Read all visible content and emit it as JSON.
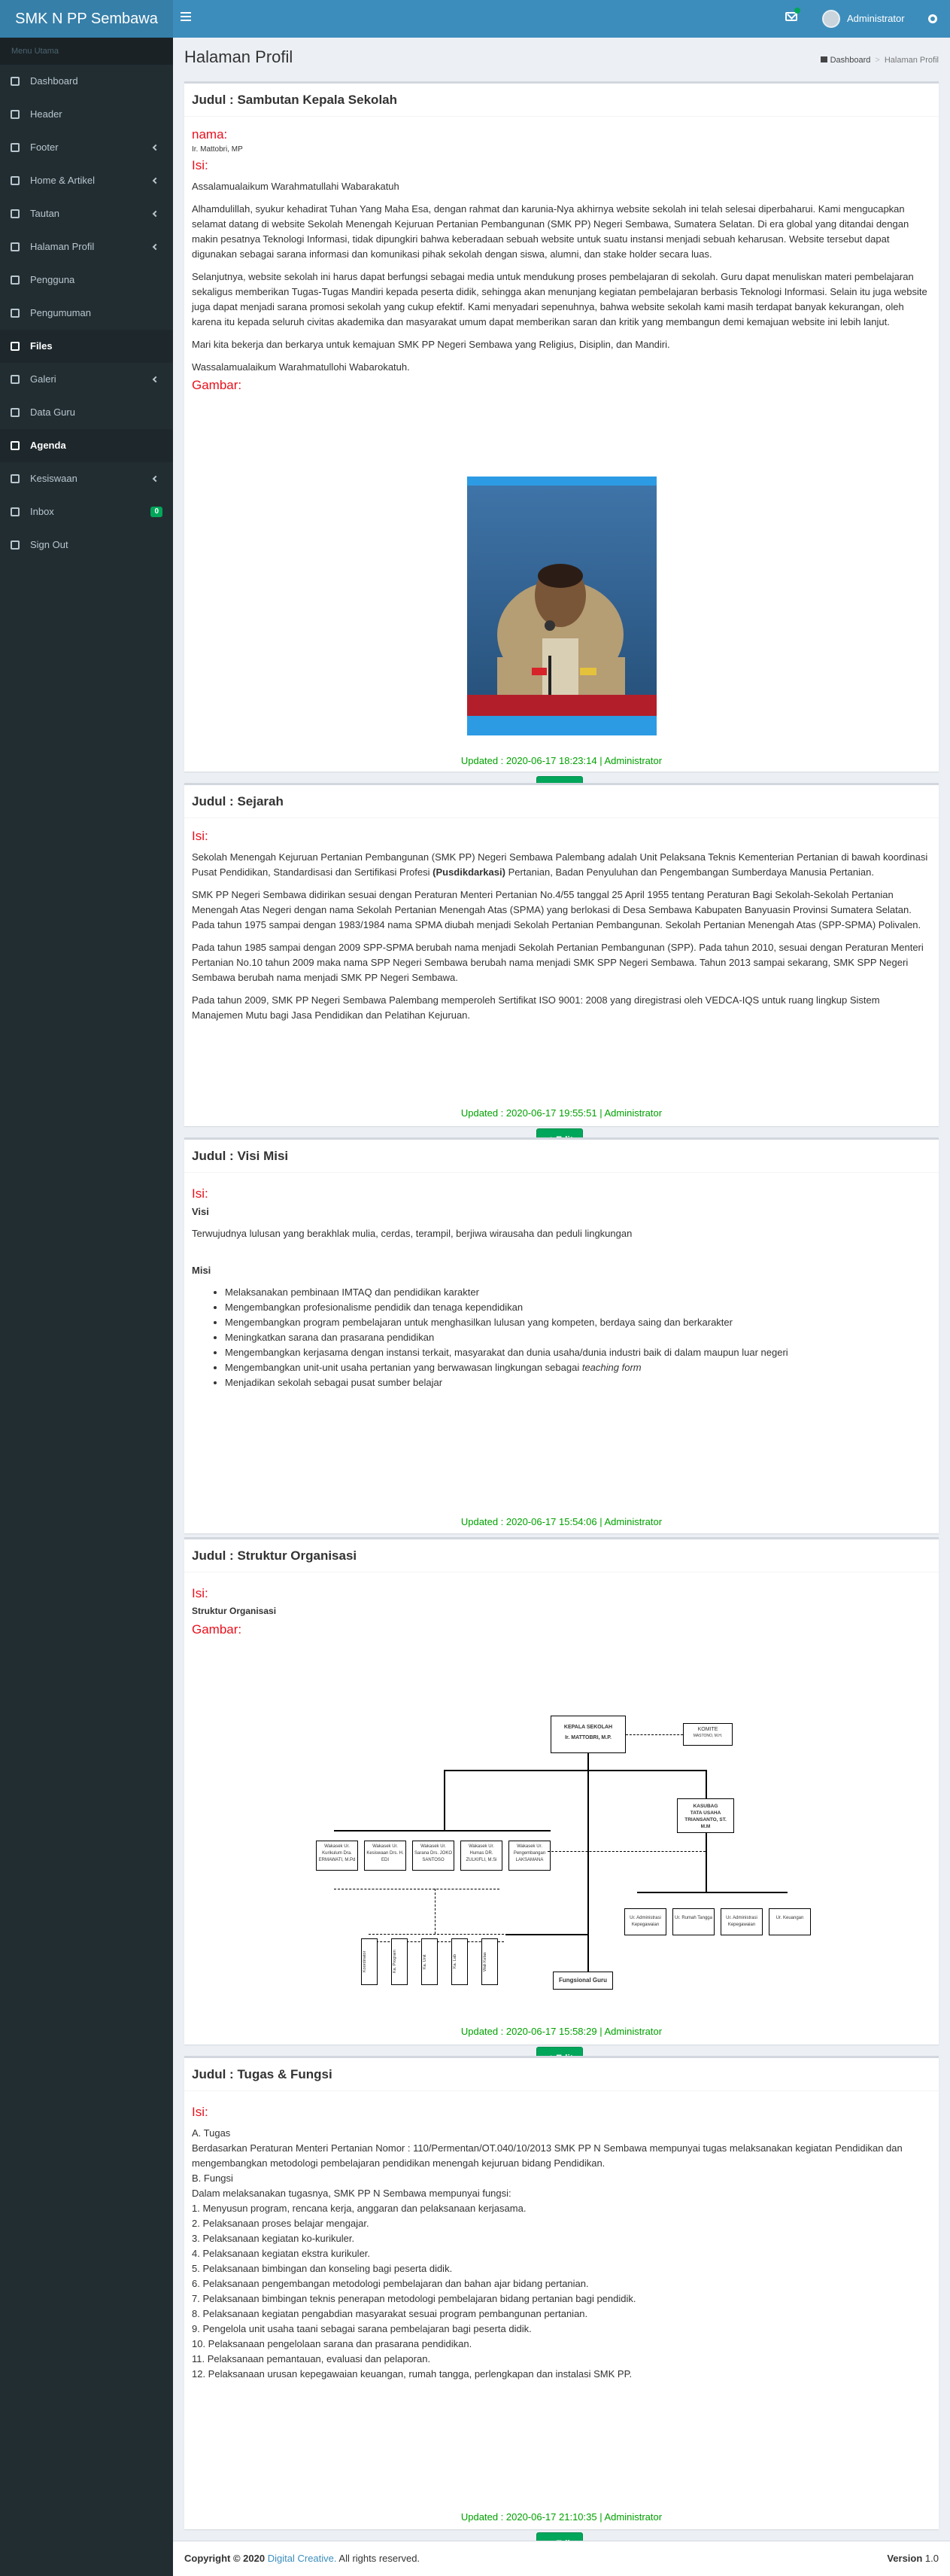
{
  "header": {
    "logo": "SMK N PP Sembawa",
    "user": "Administrator"
  },
  "sidebar": {
    "title": "Menu Utama",
    "items": [
      {
        "label": "Dashboard",
        "icon": "dashboard-icon",
        "caret": false,
        "active": false
      },
      {
        "label": "Header",
        "icon": "list-icon",
        "caret": false,
        "active": false
      },
      {
        "label": "Footer",
        "icon": "list-icon",
        "caret": true,
        "active": false
      },
      {
        "label": "Home & Artikel",
        "icon": "newspaper-icon",
        "caret": true,
        "active": false
      },
      {
        "label": "Tautan",
        "icon": "link-icon",
        "caret": true,
        "active": false
      },
      {
        "label": "Halaman Profil",
        "icon": "home-icon",
        "caret": true,
        "active": false
      },
      {
        "label": "Pengguna",
        "icon": "users-icon",
        "caret": false,
        "active": false
      },
      {
        "label": "Pengumuman",
        "icon": "bullhorn-icon",
        "caret": false,
        "active": false
      },
      {
        "label": "Files",
        "icon": "files-icon",
        "caret": false,
        "active": true
      },
      {
        "label": "Galeri",
        "icon": "image-icon",
        "caret": true,
        "active": false
      },
      {
        "label": "Data Guru",
        "icon": "users-icon",
        "caret": false,
        "active": false
      },
      {
        "label": "Agenda",
        "icon": "calendar-icon",
        "caret": false,
        "active": true
      },
      {
        "label": "Kesiswaan",
        "icon": "user-icon",
        "caret": true,
        "active": false
      },
      {
        "label": "Inbox",
        "icon": "inbox-icon",
        "caret": false,
        "active": false,
        "badge": "0"
      },
      {
        "label": "Sign Out",
        "icon": "sign-out-icon",
        "caret": false,
        "active": false
      }
    ]
  },
  "page": {
    "title": "Halaman Profil",
    "breadcrumb": [
      "Dashboard",
      "Halaman Profil"
    ]
  },
  "labels": {
    "nama": "nama:",
    "isi": "Isi:",
    "gambar": "Gambar:",
    "edit": "Edit"
  },
  "sections": {
    "sambutan": {
      "title": "Judul : Sambutan Kepala Sekolah",
      "nama": "Ir. Mattobri, MP",
      "paragraphs": [
        "Assalamualaikum Warahmatullahi Wabarakatuh",
        "Alhamdulillah, syukur kehadirat Tuhan Yang Maha Esa, dengan rahmat dan karunia-Nya akhirnya website sekolah ini telah selesai diperbaharui. Kami mengucapkan selamat datang di website Sekolah Menengah Kejuruan Pertanian Pembangunan (SMK PP) Negeri Sembawa, Sumatera Selatan. Di era global yang ditandai dengan makin pesatnya Teknologi Informasi, tidak dipungkiri bahwa keberadaan sebuah website untuk suatu instansi menjadi sebuah keharusan. Website tersebut dapat digunakan sebagai sarana informasi dan komunikasi pihak sekolah dengan siswa, alumni, dan stake holder secara luas.",
        "Selanjutnya, website sekolah ini harus dapat berfungsi sebagai media untuk mendukung proses pembelajaran di sekolah. Guru dapat menuliskan materi pembelajaran sekaligus memberikan Tugas-Tugas Mandiri kepada peserta didik, sehingga akan menunjang kegiatan pembelajaran berbasis Teknologi Informasi. Selain itu juga website juga dapat menjadi sarana promosi sekolah yang cukup efektif. Kami menyadari sepenuhnya, bahwa website sekolah kami masih terdapat banyak kekurangan, oleh karena itu kepada seluruh civitas akademika dan masyarakat umum dapat memberikan saran dan kritik yang membangun demi kemajuan website ini lebih lanjut.",
        "Mari kita bekerja dan berkarya untuk kemajuan SMK PP Negeri Sembawa yang Religius, Disiplin, dan Mandiri.",
        "Wassalamualaikum Warahmatullohi Wabarokatuh."
      ],
      "updated": "Updated : 2020-06-17 18:23:14 | Administrator"
    },
    "sejarah": {
      "title": "Judul : Sejarah",
      "p1a": "Sekolah Menengah Kejuruan Pertanian Pembangunan (SMK PP) Negeri Sembawa Palembang adalah Unit Pelaksana Teknis Kementerian Pertanian di bawah koordinasi Pusat Pendidikan, Standardisasi dan Sertifikasi Profesi ",
      "p1b": "(Pusdikdarkasi)",
      "p1c": " Pertanian, Badan Penyuluhan dan Pengembangan Sumberdaya Manusia Pertanian.",
      "paragraphs": [
        "SMK PP Negeri Sembawa didirikan sesuai dengan Peraturan Menteri Pertanian No.4/55 tanggal 25 April 1955  tentang Peraturan Bagi Sekolah-Sekolah Pertanian Menengah Atas Negeri dengan nama Sekolah Pertanian Menengah Atas (SPMA) yang berlokasi di Desa Sembawa Kabupaten Banyuasin Provinsi Sumatera Selatan. Pada tahun 1975 sampai dengan 1983/1984 nama SPMA diubah menjadi Sekolah Pertanian Pembangunan. Sekolah Pertanian Menengah Atas (SPP-SPMA) Polivalen.",
        "Pada tahun 1985 sampai dengan 2009 SPP-SPMA berubah nama menjadi Sekolah Pertanian Pembangunan (SPP).  Pada tahun 2010, sesuai dengan Peraturan Menteri Pertanian No.10 tahun 2009 maka nama SPP Negeri Sembawa berubah nama menjadi SMK SPP Negeri Sembawa. Tahun 2013 sampai sekarang, SMK SPP Negeri Sembawa berubah nama menjadi SMK PP Negeri Sembawa.",
        "Pada tahun 2009, SMK PP Negeri Sembawa Palembang memperoleh Sertifikat ISO 9001: 2008 yang diregistrasi oleh VEDCA-IQS untuk ruang lingkup Sistem Manajemen Mutu bagi Jasa Pendidikan dan Pelatihan Kejuruan."
      ],
      "updated": "Updated : 2020-06-17 19:55:51 | Administrator"
    },
    "visimisi": {
      "title": "Judul : Visi Misi",
      "visi_heading": "Visi",
      "visi_text": "Terwujudnya lulusan yang berakhlak mulia, cerdas, terampil, berjiwa  wirausaha dan peduli lingkungan",
      "misi_heading": "Misi",
      "misi": [
        "Melaksanakan pembinaan IMTAQ dan pendidikan karakter",
        "Mengembangkan profesionalisme pendidik dan tenaga kependidikan",
        "Mengembangkan program pembelajaran untuk menghasilkan lulusan yang kompeten, berdaya saing dan berkarakter",
        "Meningkatkan sarana dan prasarana pendidikan",
        "Mengembangkan kerjasama dengan instansi terkait, masyarakat dan dunia usaha/dunia industri baik di dalam maupun luar negeri",
        "Mengembangkan unit-unit usaha pertanian yang berwawasan lingkungan sebagai "
      ],
      "misi_italic": "teaching form",
      "misi_last": "Menjadikan sekolah sebagai pusat sumber belajar",
      "updated": "Updated : 2020-06-17 15:54:06 | Administrator"
    },
    "struktur": {
      "title": "Judul : Struktur Organisasi",
      "subtitle": "Struktur Organisasi",
      "org": {
        "kepala_line1": "KEPALA SEKOLAH",
        "kepala_line2": "Ir. MATTOBRI, M.P.",
        "komite_line1": "KOMITE",
        "komite_line2": "MASTONO, M.H.",
        "kasubag_line1": "KASUBAG",
        "kasubag_line2": "TATA USAHA",
        "kasubag_line3": "TRIANSANTO, ST.",
        "kasubag_line4": "M.M",
        "wakasek": [
          "Wakasek Ur. Kurikulum Dra. ERMAWATI, M.Pd",
          "Wakasek Ur. Kesiswaan Drs. H. EDI",
          "Wakasek Ur. Sarana Drs. JOKO SANTOSO",
          "Wakasek Ur. Humas DR. ZULKIFLI, M.Si",
          "Wakasek Ur. Pengembangan LAKSAMANA"
        ],
        "ur": [
          "Ur. Administrasi Kepegawaian",
          "Ur. Rumah Tangga",
          "Ur. Administrasi Kepegawaian",
          "Ur. Keuangan"
        ],
        "vert": [
          "Koordinator",
          "Ka. Program",
          "Ka. Unit",
          "Ka. Lab",
          "Wali Kelas"
        ],
        "guru": "Fungsional Guru"
      },
      "updated": "Updated : 2020-06-17 15:58:29 | Administrator"
    },
    "tugas": {
      "title": "Judul : Tugas & Fungsi",
      "lines": [
        "A. Tugas",
        "Berdasarkan Peraturan Menteri Pertanian Nomor : 110/Permentan/OT.040/10/2013 SMK PP N Sembawa mempunyai tugas melaksanakan kegiatan Pendidikan dan",
        "mengembangkan metodologi pembelajaran pendidikan menengah kejuruan bidang Pendidikan.",
        "B. Fungsi",
        "Dalam melaksanakan tugasnya, SMK PP N Sembawa mempunyai fungsi:",
        "1. Menyusun program, rencana kerja, anggaran dan pelaksanaan kerjasama.",
        "2. Pelaksanaan proses belajar mengajar.",
        "3. Pelaksanaan kegiatan ko-kurikuler.",
        "4. Pelaksanaan kegiatan ekstra kurikuler.",
        "5. Pelaksanaan bimbingan dan konseling bagi peserta didik.",
        "6. Pelaksanaan pengembangan metodologi pembelajaran dan bahan ajar bidang pertanian.",
        "7. Pelaksanaan bimbingan teknis penerapan metodologi pembelajaran bidang pertanian bagi pendidik.",
        "8. Pelaksanaan kegiatan pengabdian masyarakat sesuai program pembangunan pertanian.",
        "9. Pengelola unit usaha taani sebagai sarana pembelajaran bagi peserta didik.",
        "10. Pelaksanaan pengelolaan sarana dan prasarana pendidikan.",
        "11. Pelaksanaan pemantauan, evaluasi dan pelaporan.",
        "12. Pelaksanaan urusan kepegawaian keuangan, rumah tangga, perlengkapan dan instalasi SMK PP."
      ],
      "updated": "Updated : 2020-06-17 21:10:35 | Administrator"
    }
  },
  "footer": {
    "copyright": "Copyright © 2020",
    "company": "Digital Creative.",
    "rights": " All rights reserved.",
    "version_label": "Version",
    "version": "1.0"
  }
}
